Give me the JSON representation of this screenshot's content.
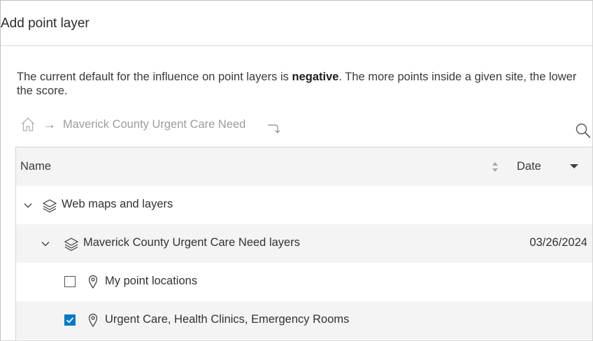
{
  "dialog": {
    "title": "Add point layer",
    "description_prefix": "The current default for the influence on point layers is ",
    "description_bold": "negative",
    "description_suffix": ". The more points inside a given site, the lower the score."
  },
  "breadcrumb": {
    "home_icon": "home-icon",
    "separator": "→",
    "current": "Maverick County Urgent Care Need",
    "return_icon": "return-arrow-icon"
  },
  "search": {
    "icon": "search-icon"
  },
  "table": {
    "columns": {
      "name": "Name",
      "date": "Date"
    },
    "sort_icon": "sort-icon",
    "date_sort_icon": "caret-down-icon",
    "rows": [
      {
        "type": "group",
        "label": "Web maps and layers",
        "date": "",
        "expanded": true
      },
      {
        "type": "map",
        "label": "Maverick County Urgent Care Need layers",
        "date": "03/26/2024",
        "expanded": true
      },
      {
        "type": "layer",
        "label": "My point locations",
        "checked": false
      },
      {
        "type": "layer",
        "label": "Urgent Care, Health Clinics, Emergency Rooms",
        "checked": true
      }
    ]
  },
  "colors": {
    "accent": "#007ac2",
    "row_alt": "#f4f4f4",
    "muted_text": "#9d9d9d"
  }
}
